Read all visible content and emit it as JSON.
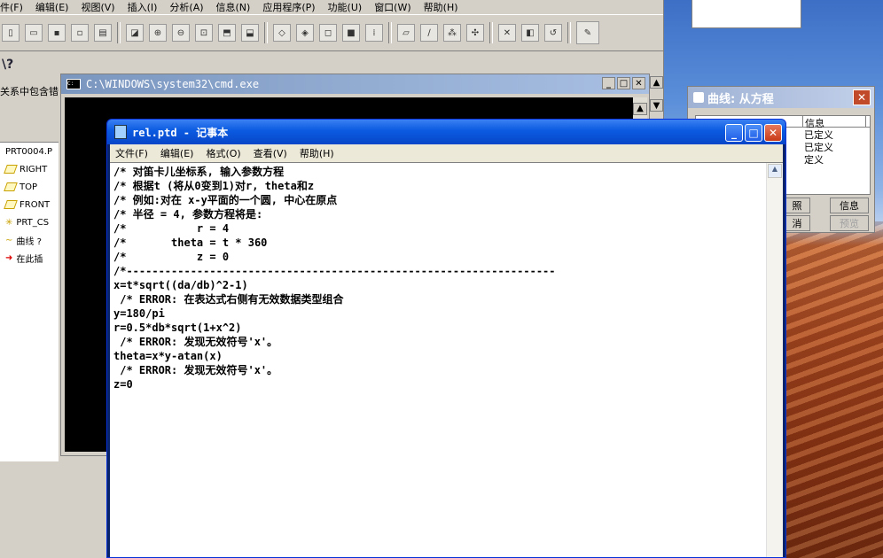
{
  "proe": {
    "menu": [
      "件(F)",
      "编辑(E)",
      "视图(V)",
      "插入(I)",
      "分析(A)",
      "信息(N)",
      "应用程序(P)",
      "功能(U)",
      "窗口(W)",
      "帮助(H)"
    ],
    "help_glyph": "\\?",
    "relation_text": "关系中包含错",
    "tree": [
      "PRT0004.P",
      "RIGHT",
      "TOP",
      "FRONT",
      "PRT_CS",
      "曲线 ?",
      "在此插"
    ]
  },
  "cmd": {
    "title": "C:\\WINDOWS\\system32\\cmd.exe"
  },
  "curve_dialog": {
    "title": "曲线: 从方程",
    "column_info": "信息",
    "rows": [
      "已定义",
      "已定义",
      "定义"
    ],
    "btn_ref": "照",
    "btn_cancel": "消",
    "btn_info": "信息",
    "btn_preview": "预览"
  },
  "notepad": {
    "title": "rel.ptd - 记事本",
    "menu": [
      "文件(F)",
      "编辑(E)",
      "格式(O)",
      "查看(V)",
      "帮助(H)"
    ],
    "lines": [
      "/* 对笛卡儿坐标系, 输入参数方程",
      "/* 根据t (将从0变到1)对r, theta和z",
      "/* 例如:对在 x-y平面的一个圆, 中心在原点",
      "/* 半径 = 4, 参数方程将是:",
      "/*           r = 4",
      "/*       theta = t * 360",
      "/*           z = 0",
      "/*-------------------------------------------------------------------",
      "x=t*sqrt((da/db)^2-1)",
      " /* ERROR: 在表达式右侧有无效数据类型组合",
      "y=180/pi",
      "r=0.5*db*sqrt(1+x^2)",
      " /* ERROR: 发现无效符号'x'。",
      "theta=x*y-atan(x)",
      " /* ERROR: 发现无效符号'x'。",
      "z=0"
    ]
  }
}
